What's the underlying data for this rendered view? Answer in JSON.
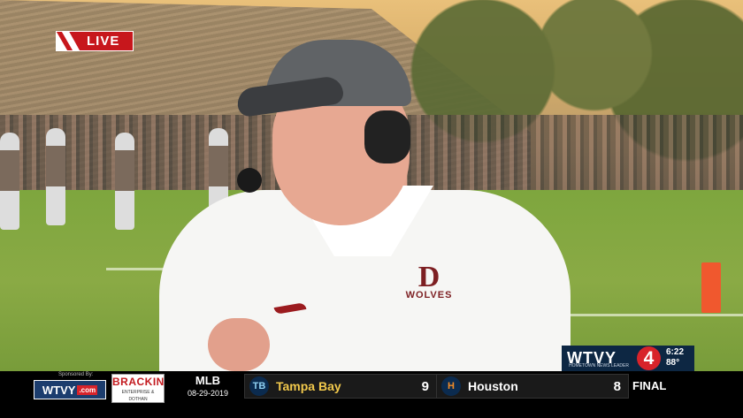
{
  "overlay": {
    "live_label": "LIVE"
  },
  "coach_logo": {
    "letter": "D",
    "word": "WOLVES"
  },
  "station_bug": {
    "brand": "WTVY",
    "channel": "4",
    "tagline": "HOMETOWN NEWS LEADER",
    "time": "6:22",
    "temp": "88°"
  },
  "ticker": {
    "sponsored_by": "Sponsored By:",
    "wtvy_logo": "WTVY",
    "wtvy_com": ".com",
    "sponsor_name": "BRACKIN",
    "sponsor_sub": "ENTERPRISE & DOTHAN",
    "league": "MLB",
    "date": "08-29-2019",
    "team_a": {
      "name": "Tampa Bay",
      "score": "9",
      "logo": "TB",
      "color": "#f2c94c"
    },
    "team_b": {
      "name": "Houston",
      "score": "8",
      "logo": "H",
      "color": "#ffffff"
    },
    "status": "FINAL"
  }
}
